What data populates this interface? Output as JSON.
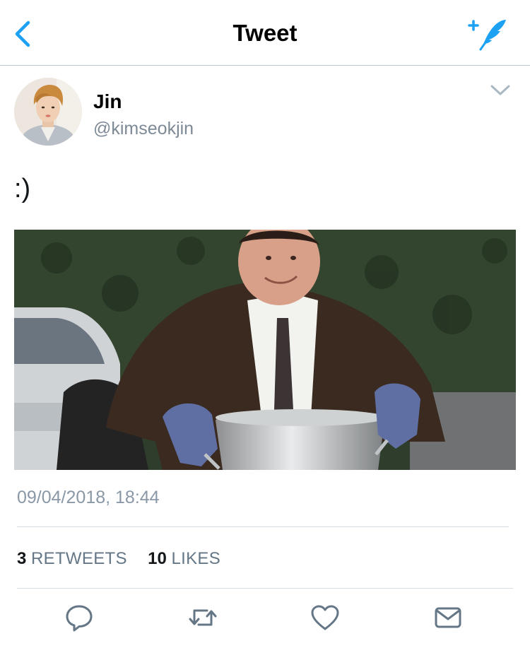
{
  "nav": {
    "title": "Tweet",
    "back_icon": "chevron-left-icon",
    "compose_icon": "compose-tweet-icon"
  },
  "tweet": {
    "author_name": "Jin",
    "author_handle": "@kimseokjin",
    "text": ":)",
    "timestamp": "09/04/2018, 18:44",
    "retweets_count": "3",
    "retweets_label": "RETWEETS",
    "likes_count": "10",
    "likes_label": "LIKES"
  },
  "actions": [
    {
      "icon": "reply-icon"
    },
    {
      "icon": "retweet-icon"
    },
    {
      "icon": "like-icon"
    },
    {
      "icon": "direct-message-icon"
    }
  ],
  "colors": {
    "accent": "#1da1f2",
    "icon_gray": "#657786",
    "handle_gray": "#7d8a96",
    "divider": "#d6dde3"
  }
}
